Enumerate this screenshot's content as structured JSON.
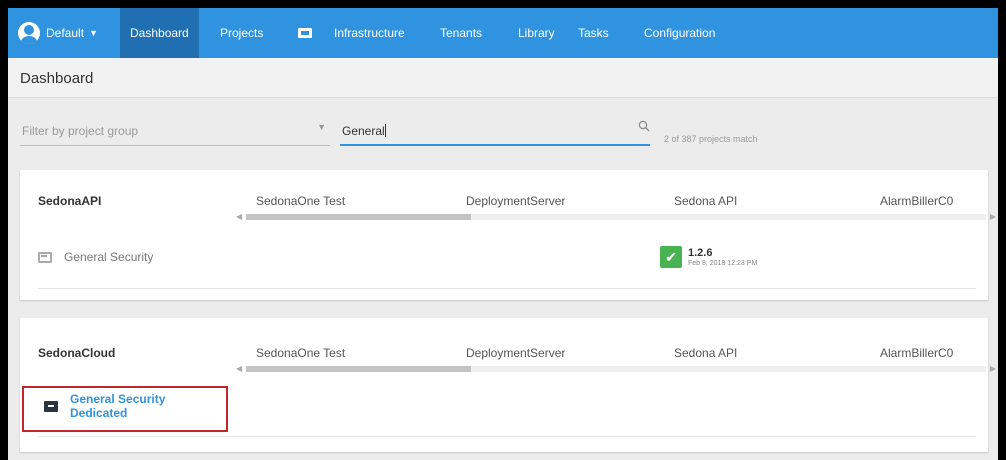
{
  "nav": {
    "space_label": "Default",
    "items": [
      "Dashboard",
      "Projects",
      "Infrastructure",
      "Tenants",
      "Library",
      "Tasks",
      "Configuration"
    ]
  },
  "page": {
    "title": "Dashboard"
  },
  "filters": {
    "group_placeholder": "Filter by project group",
    "search_value": "General",
    "match_count": "2 of 387 projects match"
  },
  "environments": [
    "SedonaOne Test",
    "DeploymentServer",
    "Sedona API",
    "AlarmBillerC0"
  ],
  "groups": [
    {
      "name": "SedonaAPI",
      "project": "General Security",
      "deployment": {
        "version": "1.2.6",
        "date": "Feb 8, 2018 12:23 PM",
        "status": "success"
      }
    },
    {
      "name": "SedonaCloud",
      "project": "General Security Dedicated"
    }
  ],
  "colors": {
    "nav_bg": "#2f93e0",
    "active_nav": "#1f6fb2",
    "success": "#48b350",
    "highlight": "#c0272d"
  }
}
